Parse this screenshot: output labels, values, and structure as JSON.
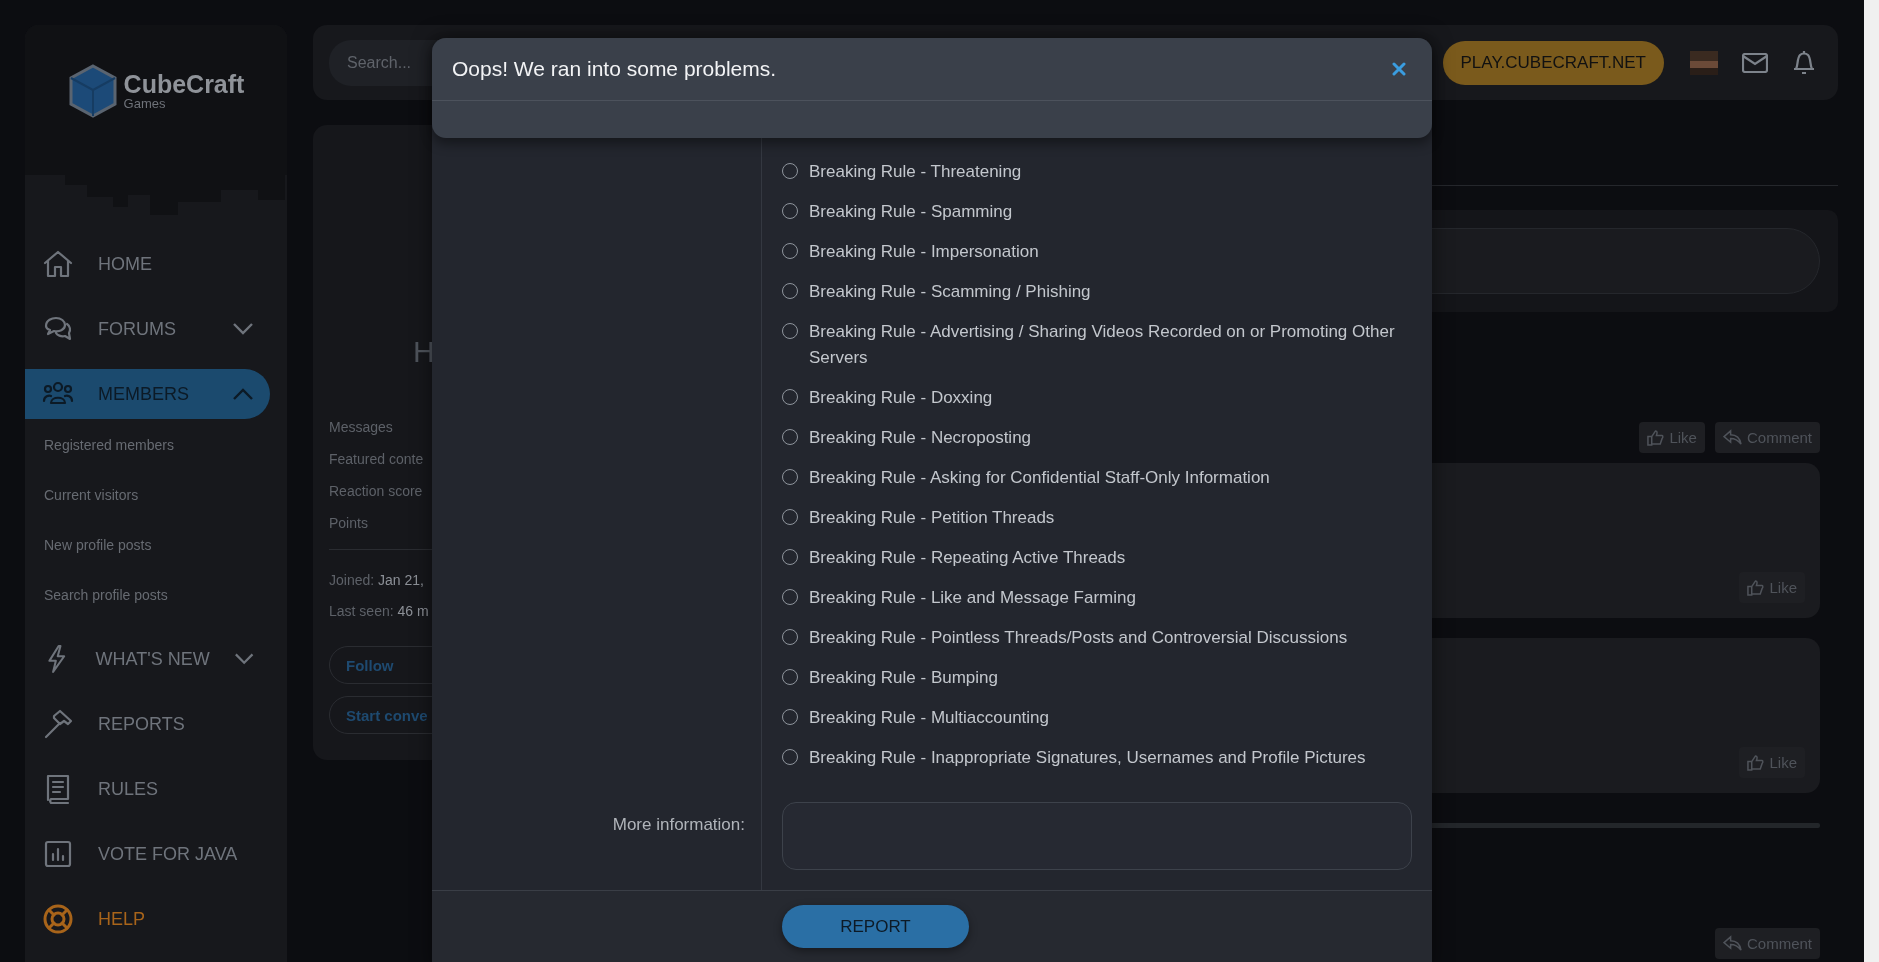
{
  "logo": {
    "name": "CubeCraft",
    "sub": "Games"
  },
  "nav": [
    {
      "label": "HOME",
      "kind": "home",
      "selected": false
    },
    {
      "label": "FORUMS",
      "kind": "chat",
      "selected": false,
      "expanded": false
    },
    {
      "label": "MEMBERS",
      "kind": "people",
      "selected": true,
      "expanded": true,
      "children": [
        {
          "label": "Registered members"
        },
        {
          "label": "Current visitors"
        },
        {
          "label": "New profile posts"
        },
        {
          "label": "Search profile posts"
        }
      ]
    },
    {
      "label": "WHAT'S NEW",
      "kind": "bolt",
      "selected": false,
      "expanded": false
    },
    {
      "label": "REPORTS",
      "kind": "hammer",
      "selected": false
    },
    {
      "label": "RULES",
      "kind": "book",
      "selected": false
    },
    {
      "label": "VOTE FOR JAVA",
      "kind": "chart",
      "selected": false
    },
    {
      "label": "HELP",
      "kind": "help",
      "selected": false
    }
  ],
  "topbar": {
    "search_placeholder": "Search...",
    "play_button": "PLAY.CUBECRAFT.NET"
  },
  "profile": {
    "name": "H",
    "stats": [
      "Messages",
      "Featured conte",
      "Reaction score",
      "Points"
    ],
    "joined": {
      "label": "Joined:",
      "value": "Jan 21,"
    },
    "last_seen": {
      "label": "Last seen:",
      "value": "46 m"
    },
    "follow_button": "Follow",
    "conversation_button": "Start conve"
  },
  "feed": {
    "like": "Like",
    "comment": "Comment",
    "post_likes": [
      "Like",
      "Like"
    ],
    "bottom_comment": "Comment"
  },
  "modal": {
    "title": "Oops! We ran into some problems.",
    "options": [
      {
        "label": "Breaking Rule - Threatening",
        "selected": false
      },
      {
        "label": "Breaking Rule - Spamming",
        "selected": false
      },
      {
        "label": "Breaking Rule - Impersonation",
        "selected": false
      },
      {
        "label": "Breaking Rule - Scamming / Phishing",
        "selected": false
      },
      {
        "label": "Breaking Rule - Advertising / Sharing Videos Recorded on or Promoting Other Servers",
        "selected": false
      },
      {
        "label": "Breaking Rule - Doxxing",
        "selected": false
      },
      {
        "label": "Breaking Rule - Necroposting",
        "selected": false
      },
      {
        "label": "Breaking Rule - Asking for Confidential Staff-Only Information",
        "selected": false
      },
      {
        "label": "Breaking Rule - Petition Threads",
        "selected": false
      },
      {
        "label": "Breaking Rule - Repeating Active Threads",
        "selected": false
      },
      {
        "label": "Breaking Rule - Like and Message Farming",
        "selected": false
      },
      {
        "label": "Breaking Rule - Pointless Threads/Posts and Controversial Discussions",
        "selected": false
      },
      {
        "label": "Breaking Rule - Bumping",
        "selected": false
      },
      {
        "label": "Breaking Rule - Multiaccounting",
        "selected": false
      },
      {
        "label": "Breaking Rule - Inappropriate Signatures, Usernames and Profile Pictures",
        "selected": false
      }
    ],
    "more_info_label": "More information:",
    "submit": "REPORT"
  }
}
